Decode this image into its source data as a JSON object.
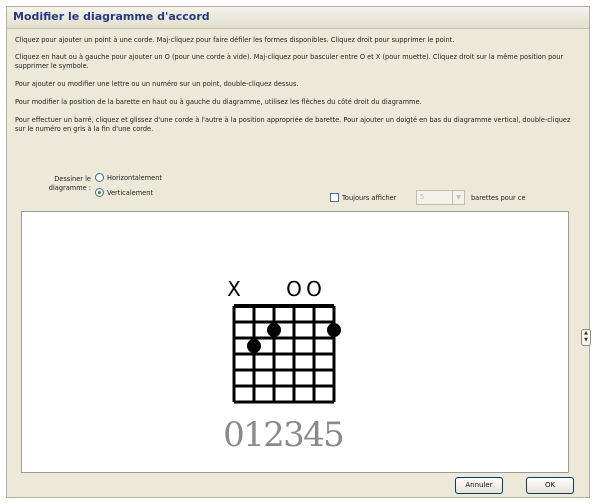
{
  "dialog": {
    "title": "Modifier le diagramme d'accord",
    "instructions": [
      "Cliquez pour ajouter un point à une corde. Maj-cliquez pour faire défiler les formes disponibles. Cliquez droit pour supprimer le point.",
      "Cliquez en haut ou à gauche pour ajouter un O (pour une corde à vide). Maj-cliquez pour basculer entre O et X (pour muette). Cliquez droit sur la même position pour supprimer le symbole.",
      "Pour ajouter ou modifier une lettre ou un numéro sur un point, double-cliquez dessus.",
      "Pour modifier la position de la barette en haut ou à gauche du diagramme, utilisez les flèches du côté droit du diagramme.",
      "Pour effectuer un barré, cliquez et glissez d'une corde à l'autre à la position appropriée de barette. Pour ajouter un doigté en bas du diagramme vertical, double-cliquez sur le numéro en gris à la fin d'une corde."
    ],
    "draw_label": "Dessiner le diagramme :",
    "orientation_options": [
      "Horizontalement",
      "Verticalement"
    ],
    "orientation_selected": "Verticalement",
    "always_show_label": "Toujours afficher",
    "always_show_checked": false,
    "frets_value": "5",
    "frets_suffix": "barettes pour ce",
    "cancel_label": "Annuler",
    "ok_label": "OK"
  },
  "diagram": {
    "string_markers": [
      "X",
      "",
      "",
      "O",
      "O",
      ""
    ],
    "dots": [
      {
        "string": 2,
        "fret": 3
      },
      {
        "string": 3,
        "fret": 2
      },
      {
        "string": 6,
        "fret": 2
      }
    ],
    "string_numbers": "012345"
  }
}
